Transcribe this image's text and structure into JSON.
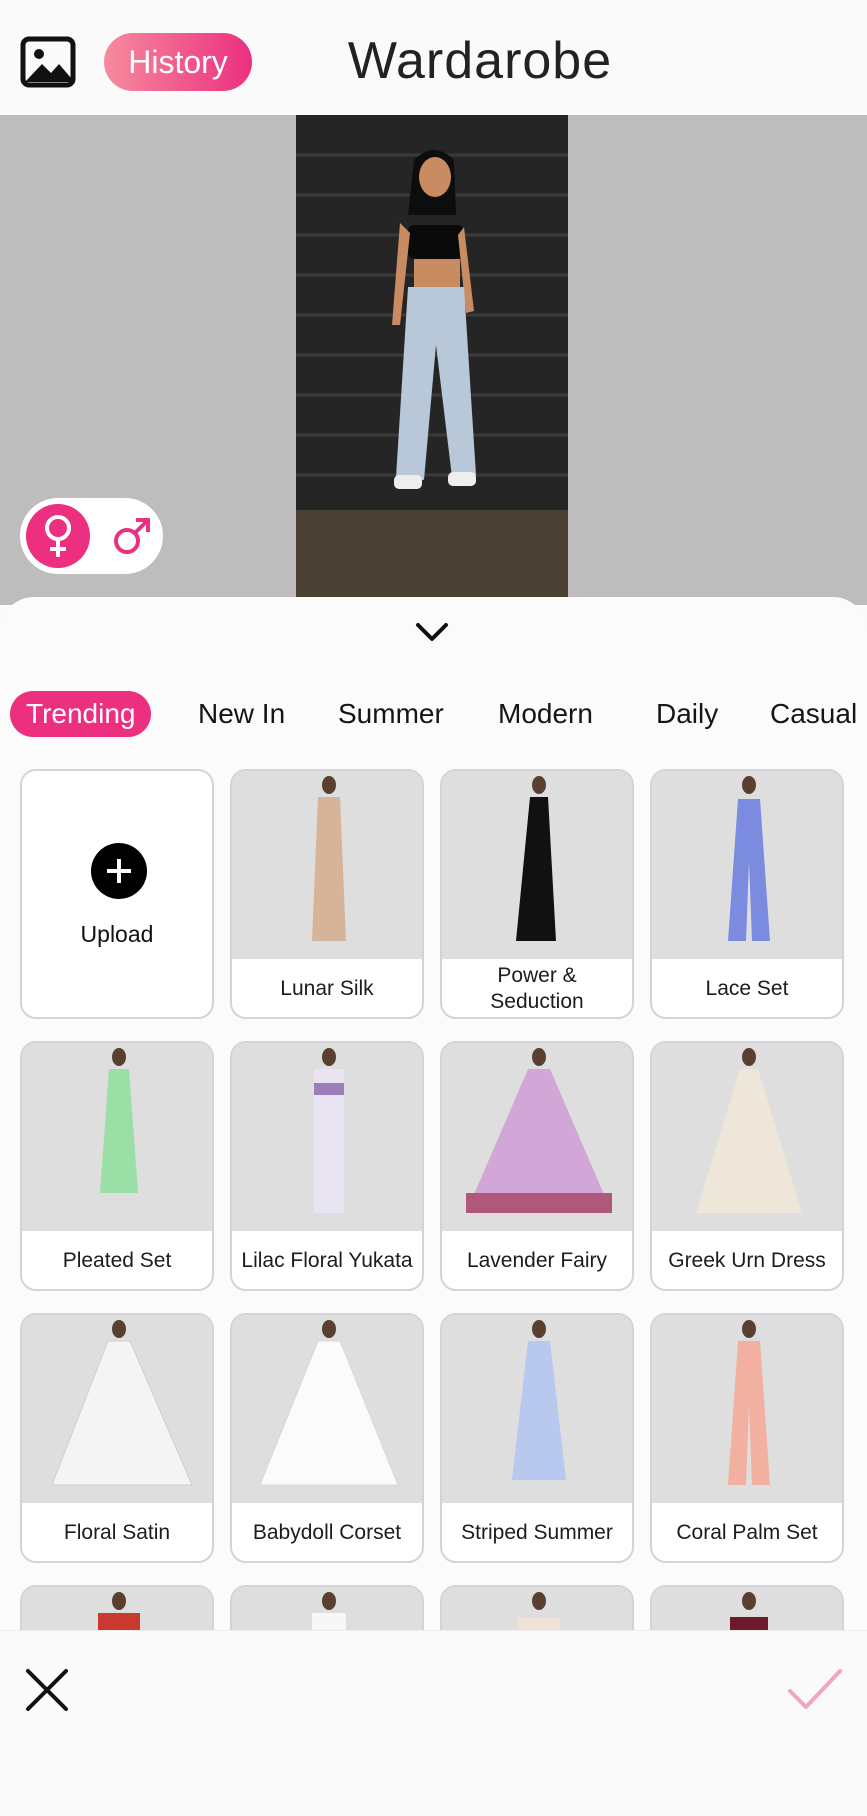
{
  "header": {
    "gallery_icon": "image-gallery-icon",
    "history_label": "History",
    "title": "Wardarobe"
  },
  "preview": {
    "gender": {
      "female_icon": "female-symbol-icon",
      "male_icon": "male-symbol-icon",
      "selected": "female"
    }
  },
  "sheet": {
    "collapse_icon": "chevron-down-icon",
    "tabs": [
      "Trending",
      "New In",
      "Summer",
      "Modern",
      "Daily",
      "Casual"
    ],
    "active_tab": "Trending",
    "upload_label": "Upload",
    "items": [
      "Lunar Silk",
      "Power & Seduction",
      "Lace Set",
      "Pleated Set",
      "Lilac Floral Yukata",
      "Lavender Fairy",
      "Greek Urn Dress",
      "Floral Satin",
      "Babydoll Corset",
      "Striped Summer",
      "Coral Palm Set"
    ]
  },
  "bottom_bar": {
    "cancel_icon": "close-icon",
    "confirm_icon": "checkmark-icon"
  },
  "colors": {
    "accent": "#ec2f7f",
    "accent_light": "#f58b9d",
    "background": "#fafafa",
    "preview_bg": "#bdbdbd",
    "tile_border": "#d4d4d4"
  }
}
